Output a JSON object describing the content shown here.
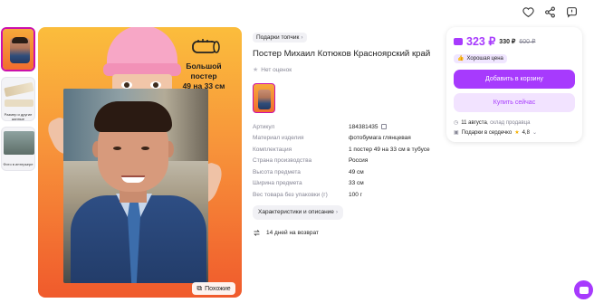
{
  "top_icons": [
    "heart-icon",
    "share-icon",
    "report-icon"
  ],
  "thumbs": [
    {
      "caption": ""
    },
    {
      "caption": "Размер и другие данные"
    },
    {
      "caption": "Фото в интерьере"
    }
  ],
  "main_image": {
    "badge": "Большой постер\n49 на 33 см",
    "similar": "Похожие"
  },
  "product": {
    "brand": "Подарки топчик",
    "title": "Постер Михаил Котюков Красноярский край",
    "rating": "Нет оценок",
    "specs": [
      {
        "k": "Артикул",
        "v": "184381435"
      },
      {
        "k": "Материал изделия",
        "v": "фотобумага глянцевая"
      },
      {
        "k": "Комплектация",
        "v": "1 постер 49 на 33 см в тубусе"
      },
      {
        "k": "Страна производства",
        "v": "Россия"
      },
      {
        "k": "Высота предмета",
        "v": "49 см"
      },
      {
        "k": "Ширина предмета",
        "v": "33 см"
      },
      {
        "k": "Вес товара без упаковки (г)",
        "v": "100 г"
      }
    ],
    "desc_button": "Характеристики и описание",
    "return_text": "14 дней на возврат"
  },
  "buy_card": {
    "price": "323 ₽",
    "price_no_wallet": "330 ₽",
    "price_old": "600 ₽",
    "good_price": "Хорошая цена",
    "add_to_cart": "Добавить в корзину",
    "buy_now": "Купить сейчас",
    "delivery_date": "11 августа",
    "delivery_from": ", склад продавца",
    "gift_text": "Подарки в сердечко",
    "seller_rating": "4,8"
  },
  "colors": {
    "accent": "#a73afd",
    "brand_pink": "#cb11ab"
  }
}
